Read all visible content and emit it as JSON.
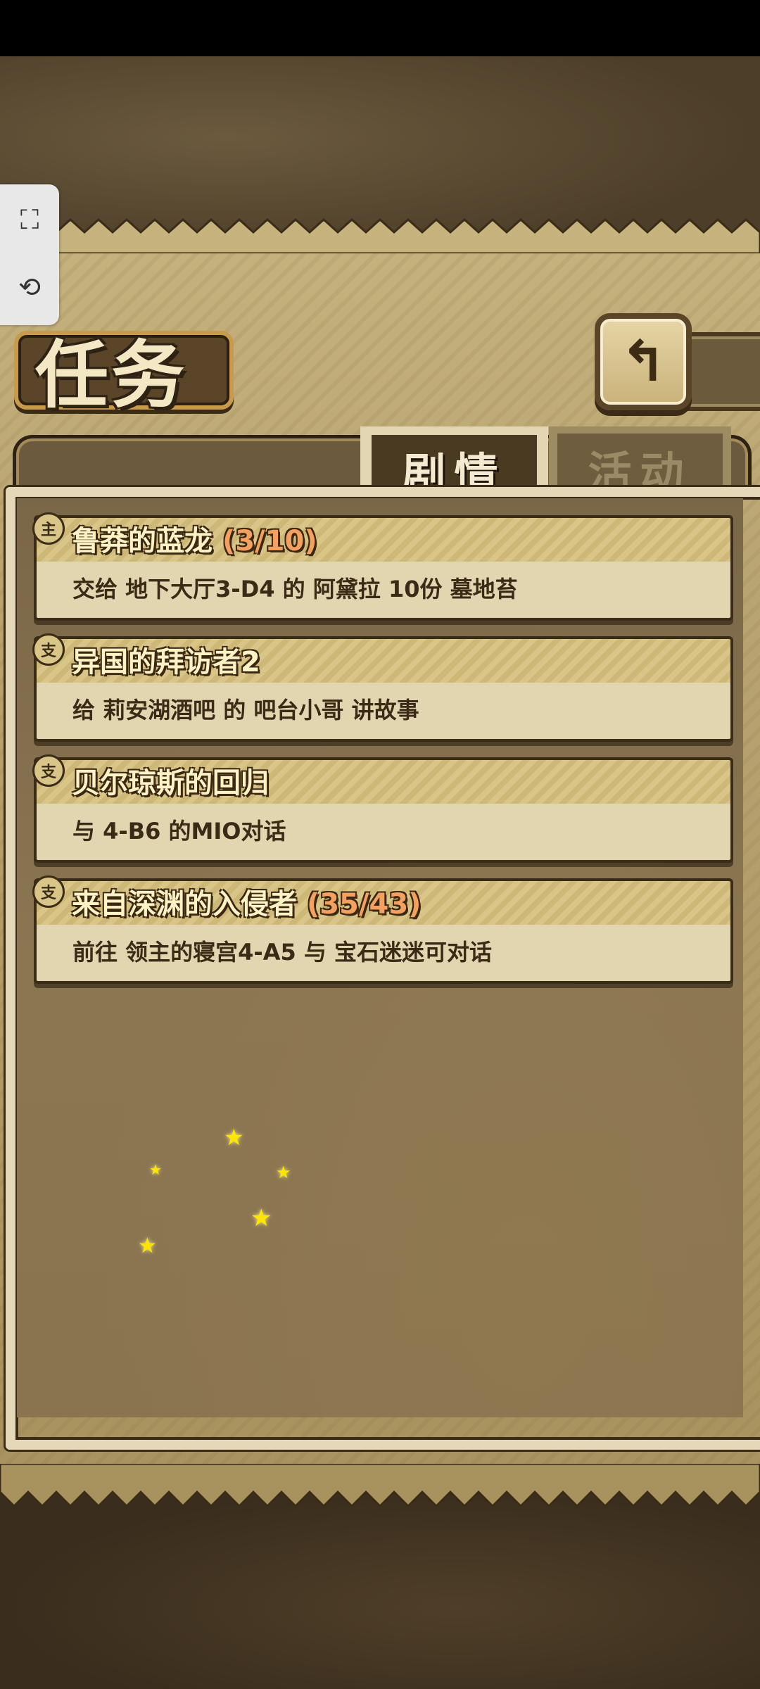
{
  "header": {
    "title": "任务",
    "back_icon": "↰"
  },
  "tabs": [
    {
      "label": "剧情",
      "active": true
    },
    {
      "label": "活动",
      "active": false
    }
  ],
  "quests": [
    {
      "icon": "主",
      "title": "鲁莽的蓝龙",
      "progress": "(3/10)",
      "desc": "交给 地下大厅3-D4 的 阿黛拉 10份 墓地苔"
    },
    {
      "icon": "支",
      "title": "异国的拜访者2",
      "progress": "",
      "desc": "给 莉安湖酒吧 的 吧台小哥 讲故事"
    },
    {
      "icon": "支",
      "title": "贝尔琼斯的回归",
      "progress": "",
      "desc": "与 4-B6 的MIO对话"
    },
    {
      "icon": "支",
      "title": "来自深渊的入侵者",
      "progress": "(35/43)",
      "desc": "前往 领主的寝宫4-A5 与 宝石迷迷可对话"
    }
  ],
  "tools": {
    "screenshot_icon": "⛶",
    "replay_icon": "⟲"
  }
}
